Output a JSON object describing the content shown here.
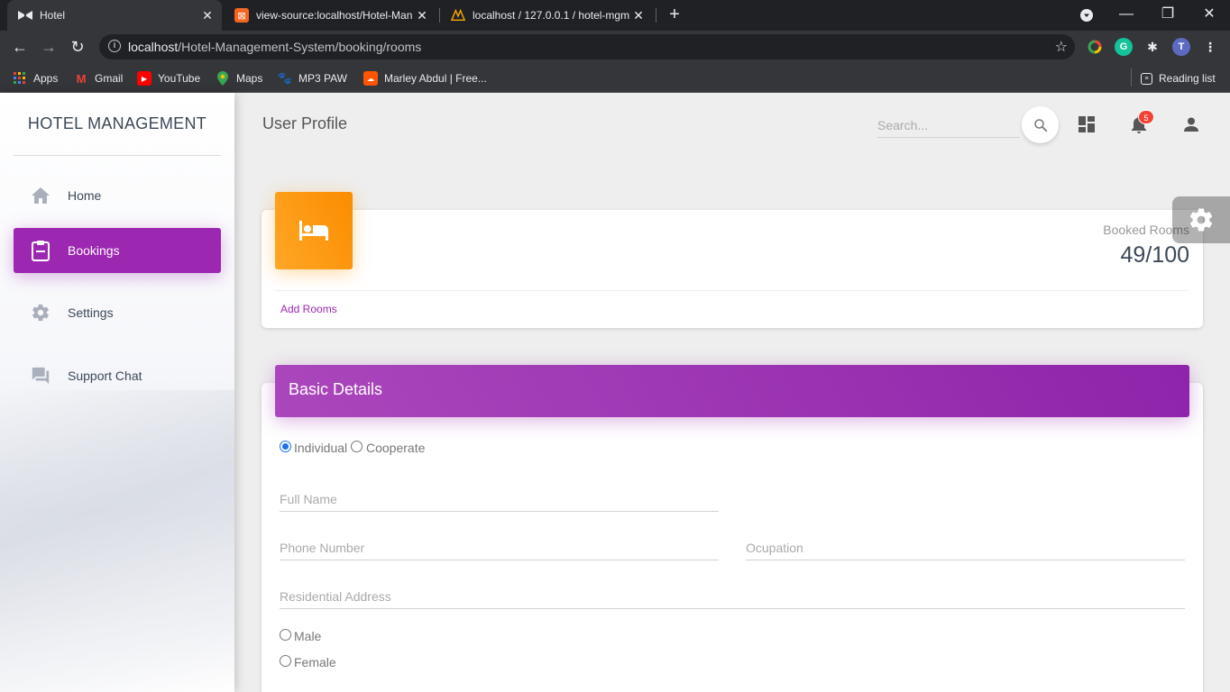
{
  "browser": {
    "tabs": [
      {
        "title": "Hotel",
        "active": true
      },
      {
        "title": "view-source:localhost/Hotel-Man",
        "active": false
      },
      {
        "title": "localhost / 127.0.0.1 / hotel-mgm",
        "active": false
      }
    ],
    "url_host": "localhost",
    "url_path": "/Hotel-Management-System/booking/rooms",
    "profile_initial": "T",
    "bookmarks": [
      "Apps",
      "Gmail",
      "YouTube",
      "Maps",
      "MP3 PAW",
      "Marley Abdul | Free..."
    ],
    "reading_list": "Reading list"
  },
  "sidebar": {
    "brand": "HOTEL MANAGEMENT",
    "items": [
      {
        "label": "Home",
        "icon": "home-icon"
      },
      {
        "label": "Bookings",
        "icon": "clipboard-icon",
        "active": true
      },
      {
        "label": "Settings",
        "icon": "gear-icon"
      },
      {
        "label": "Support Chat",
        "icon": "chat-icon"
      }
    ]
  },
  "navbar": {
    "title": "User Profile",
    "search_placeholder": "Search...",
    "notification_count": "5"
  },
  "stats": {
    "category": "Booked Rooms",
    "value": "49/100",
    "link": "Add Rooms"
  },
  "details": {
    "title": "Basic Details",
    "customer_types": [
      "Individual",
      "Cooperate"
    ],
    "fields": {
      "full_name": "Full Name",
      "phone": "Phone Number",
      "occupation": "Ocupation",
      "address": "Residential Address"
    },
    "genders": [
      "Male",
      "Female"
    ]
  },
  "colors": {
    "primary": "#9c27b0",
    "warning": "#ff9800",
    "badge": "#f44336"
  }
}
